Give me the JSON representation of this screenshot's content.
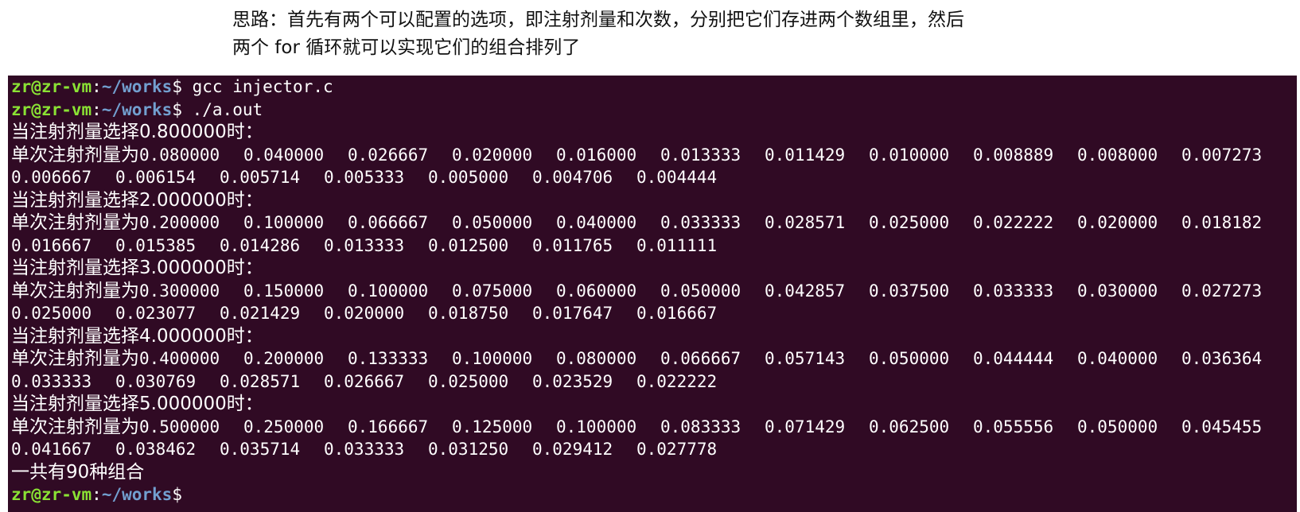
{
  "document": {
    "lines": [
      "思路：首先有两个可以配置的选项，即注射剂量和次数，分别把它们存进两个数组里，然后",
      "两个 for 循环就可以实现它们的组合排列了"
    ]
  },
  "terminal": {
    "colors": {
      "background": "#300a24",
      "user": "#8ae234",
      "path": "#729fcf",
      "text": "#ffffff"
    },
    "prompt": {
      "user": "zr@zr-vm",
      "sep": ":",
      "path": "~/works",
      "sign": "$"
    },
    "commands": [
      " gcc injector.c",
      " ./a.out"
    ],
    "blocks": [
      {
        "header": "当注射剂量选择0.800000时：",
        "prefix": "单次注射剂量为",
        "row1": [
          "0.080000",
          "0.040000",
          "0.026667",
          "0.020000",
          "0.016000",
          "0.013333",
          "0.011429",
          "0.010000",
          "0.008889",
          "0.008000",
          "0.007273"
        ],
        "row2": [
          "0.006667",
          "0.006154",
          "0.005714",
          "0.005333",
          "0.005000",
          "0.004706",
          "0.004444"
        ]
      },
      {
        "header": "当注射剂量选择2.000000时：",
        "prefix": "单次注射剂量为",
        "row1": [
          "0.200000",
          "0.100000",
          "0.066667",
          "0.050000",
          "0.040000",
          "0.033333",
          "0.028571",
          "0.025000",
          "0.022222",
          "0.020000",
          "0.018182"
        ],
        "row2": [
          "0.016667",
          "0.015385",
          "0.014286",
          "0.013333",
          "0.012500",
          "0.011765",
          "0.011111"
        ]
      },
      {
        "header": "当注射剂量选择3.000000时：",
        "prefix": "单次注射剂量为",
        "row1": [
          "0.300000",
          "0.150000",
          "0.100000",
          "0.075000",
          "0.060000",
          "0.050000",
          "0.042857",
          "0.037500",
          "0.033333",
          "0.030000",
          "0.027273"
        ],
        "row2": [
          "0.025000",
          "0.023077",
          "0.021429",
          "0.020000",
          "0.018750",
          "0.017647",
          "0.016667"
        ]
      },
      {
        "header": "当注射剂量选择4.000000时：",
        "prefix": "单次注射剂量为",
        "row1": [
          "0.400000",
          "0.200000",
          "0.133333",
          "0.100000",
          "0.080000",
          "0.066667",
          "0.057143",
          "0.050000",
          "0.044444",
          "0.040000",
          "0.036364"
        ],
        "row2": [
          "0.033333",
          "0.030769",
          "0.028571",
          "0.026667",
          "0.025000",
          "0.023529",
          "0.022222"
        ]
      },
      {
        "header": "当注射剂量选择5.000000时：",
        "prefix": "单次注射剂量为",
        "row1": [
          "0.500000",
          "0.250000",
          "0.166667",
          "0.125000",
          "0.100000",
          "0.083333",
          "0.071429",
          "0.062500",
          "0.055556",
          "0.050000",
          "0.045455"
        ],
        "row2": [
          "0.041667",
          "0.038462",
          "0.035714",
          "0.033333",
          "0.031250",
          "0.029412",
          "0.027778"
        ]
      }
    ],
    "summary": "一共有90种组合"
  }
}
